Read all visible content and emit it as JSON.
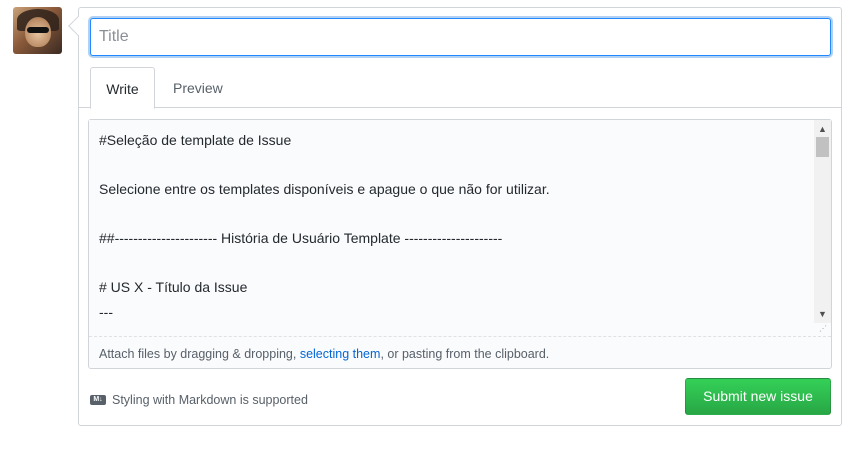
{
  "title_field": {
    "value": "",
    "placeholder": "Title"
  },
  "tabs": [
    {
      "label": "Write"
    },
    {
      "label": "Preview"
    }
  ],
  "body_lines": [
    "#Seleção de template de Issue",
    "",
    "Selecione entre os templates disponíveis e apague o que não for utilizar.",
    "",
    "##---------------------- História de Usuário Template ---------------------",
    "",
    "# US X - Título da Issue",
    "---"
  ],
  "attach": {
    "prefix": "Attach files by dragging & dropping, ",
    "link": "selecting them",
    "suffix": ", or pasting from the clipboard."
  },
  "markdown_note": {
    "icon": "markdown-icon",
    "text": "Styling with Markdown is supported"
  },
  "submit_label": "Submit new issue",
  "colors": {
    "accent": "#2188ff",
    "submit": "#28a745",
    "link": "#0366d6"
  }
}
